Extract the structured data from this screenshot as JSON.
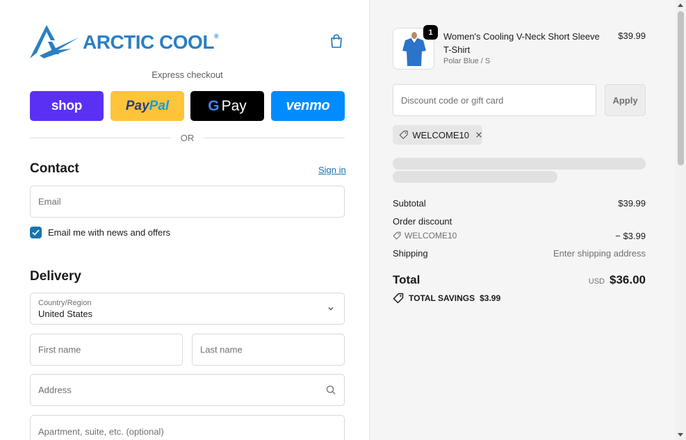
{
  "brand": {
    "name": "ARCTIC COOL",
    "registered_mark": "®",
    "color": "#2a7fc4"
  },
  "express": {
    "label": "Express checkout",
    "buttons": [
      {
        "id": "shop",
        "label": "shop",
        "color": "#5a31f4"
      },
      {
        "id": "paypal",
        "label_part1": "Pay",
        "label_part2": "Pal",
        "color": "#ffc439"
      },
      {
        "id": "gpay",
        "label_g": "G",
        "label": "Pay",
        "color": "#000000"
      },
      {
        "id": "venmo",
        "label": "venmo",
        "color": "#008cff"
      }
    ],
    "divider": "OR"
  },
  "contact": {
    "title": "Contact",
    "signin_label": "Sign in",
    "email_placeholder": "Email",
    "news_label": "Email me with news and offers",
    "news_checked": true
  },
  "delivery": {
    "title": "Delivery",
    "country_label": "Country/Region",
    "country_value": "United States",
    "first_name_placeholder": "First name",
    "last_name_placeholder": "Last name",
    "address_placeholder": "Address",
    "apartment_placeholder": "Apartment, suite, etc. (optional)"
  },
  "summary": {
    "product": {
      "name": "Women's Cooling V-Neck Short Sleeve T-Shirt",
      "variant": "Polar Blue / S",
      "price": "$39.99",
      "quantity": "1"
    },
    "discount_placeholder": "Discount code or gift card",
    "apply_label": "Apply",
    "applied_code": "WELCOME10",
    "subtotal_label": "Subtotal",
    "subtotal_value": "$39.99",
    "order_discount_label": "Order discount",
    "discount_code": "WELCOME10",
    "discount_value": "− $3.99",
    "shipping_label": "Shipping",
    "shipping_value": "Enter shipping address",
    "total_label": "Total",
    "currency": "USD",
    "total_value": "$36.00",
    "savings_label": "TOTAL SAVINGS",
    "savings_value": "$3.99"
  }
}
